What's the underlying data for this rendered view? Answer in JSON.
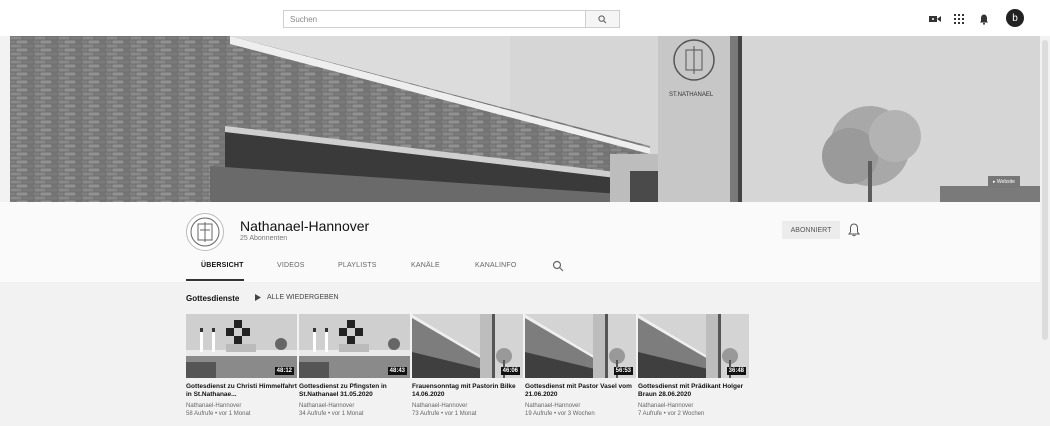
{
  "topbar": {
    "search_placeholder": "Suchen",
    "avatar_letter": "b"
  },
  "banner": {
    "tower_text": "ST.NATHANAEL",
    "website_link": "Website"
  },
  "channel": {
    "name": "Nathanael-Hannover",
    "subscribers": "25 Abonnenten",
    "subscribe_label": "ABONNIERT"
  },
  "tabs": [
    "ÜBERSICHT",
    "VIDEOS",
    "PLAYLISTS",
    "KANÄLE",
    "KANALINFO"
  ],
  "section": {
    "title": "Gottesdienste",
    "play_all": "ALLE WIEDERGEBEN"
  },
  "videos": [
    {
      "title": "Gottesdienst zu Christi Himmelfahrt in St.Nathanae...",
      "channel": "Nathanael-Hannover",
      "meta": "58 Aufrufe • vor 1 Monat",
      "duration": "48:12",
      "thumb": "altar"
    },
    {
      "title": "Gottesdienst zu Pfingsten in St.Nathanael 31.05.2020",
      "channel": "Nathanael-Hannover",
      "meta": "34 Aufrufe • vor 1 Monat",
      "duration": "48:43",
      "thumb": "altar"
    },
    {
      "title": "Frauensonntag mit Pastorin Bilke 14.06.2020",
      "channel": "Nathanael-Hannover",
      "meta": "73 Aufrufe • vor 1 Monat",
      "duration": "46:06",
      "thumb": "church"
    },
    {
      "title": "Gottesdienst mit Pastor Vasel vom 21.06.2020",
      "channel": "Nathanael-Hannover",
      "meta": "19 Aufrufe • vor 3 Wochen",
      "duration": "56:53",
      "thumb": "church"
    },
    {
      "title": "Gottesdienst mit Prädikant Holger Braun 28.06.2020",
      "channel": "Nathanael-Hannover",
      "meta": "7 Aufrufe • vor 2 Wochen",
      "duration": "36:48",
      "thumb": "church"
    }
  ],
  "colors": {
    "background": "#f2f2f2",
    "header_bg": "#fafafa",
    "accent": "#111111"
  }
}
